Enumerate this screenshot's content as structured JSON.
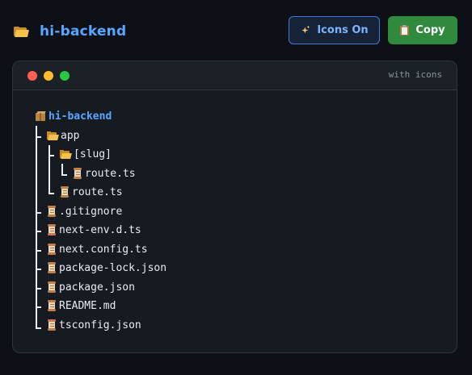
{
  "header": {
    "title": "hi-backend",
    "folder_icon": "open-folder-icon",
    "icons_button": {
      "label": "Icons On",
      "icon": "sparkles-icon"
    },
    "copy_button": {
      "label": "Copy",
      "icon": "clipboard-icon"
    }
  },
  "colors": {
    "accent": "#58a6ff",
    "copy_green": "#2f8a3e",
    "background": "#0d1117",
    "panel": "#161b22"
  },
  "panel": {
    "mode_label": "with icons",
    "window_controls": [
      "close-dot",
      "minimize-dot",
      "maximize-dot"
    ]
  },
  "tree": {
    "root": {
      "name": "hi-backend",
      "icon": "package-icon"
    },
    "entries": [
      {
        "name": "app",
        "icon": "folder-icon",
        "depth": 1
      },
      {
        "name": "[slug]",
        "icon": "folder-icon",
        "depth": 2
      },
      {
        "name": "route.ts",
        "icon": "file-scroll-icon",
        "depth": 3
      },
      {
        "name": "route.ts",
        "icon": "file-scroll-icon",
        "depth": 2
      },
      {
        "name": ".gitignore",
        "icon": "file-scroll-icon",
        "depth": 1
      },
      {
        "name": "next-env.d.ts",
        "icon": "file-scroll-icon",
        "depth": 1
      },
      {
        "name": "next.config.ts",
        "icon": "file-scroll-icon",
        "depth": 1
      },
      {
        "name": "package-lock.json",
        "icon": "file-scroll-icon",
        "depth": 1
      },
      {
        "name": "package.json",
        "icon": "file-scroll-icon",
        "depth": 1
      },
      {
        "name": "README.md",
        "icon": "file-scroll-icon",
        "depth": 1
      },
      {
        "name": "tsconfig.json",
        "icon": "file-scroll-icon",
        "depth": 1
      }
    ]
  }
}
